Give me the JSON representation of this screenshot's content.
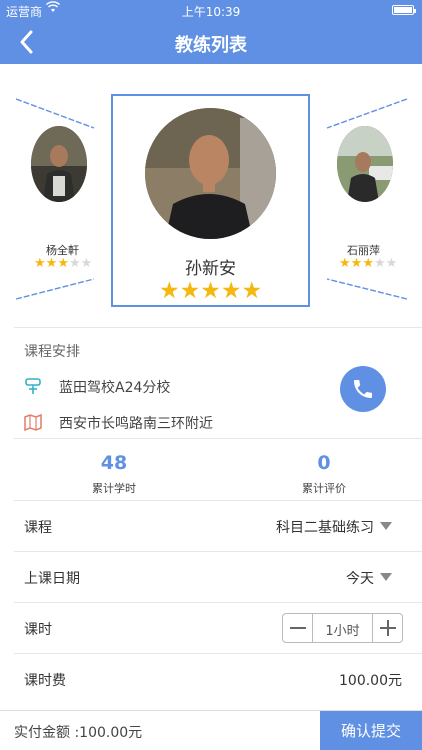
{
  "status_bar": {
    "carrier": "运营商",
    "time": "上午10:39"
  },
  "header": {
    "title": "教练列表",
    "back_icon": "chevron-left-icon"
  },
  "colors": {
    "accent": "#5f90e3",
    "star": "#f5b80f",
    "star_empty": "#d8d8d8"
  },
  "coaches": {
    "left": {
      "name": "杨全軒",
      "rating": 3,
      "max": 5
    },
    "center": {
      "name": "孙新安",
      "rating": 5,
      "max": 5
    },
    "right": {
      "name": "石丽萍",
      "rating": 3,
      "max": 5
    }
  },
  "schedule": {
    "title": "课程安排",
    "school": "蓝田驾校A24分校",
    "address": "西安市长鸣路南三环附近",
    "school_icon": "pin-icon",
    "address_icon": "map-icon",
    "phone_icon": "phone-icon"
  },
  "stats": {
    "hours": {
      "value": "48",
      "label": "累计学时"
    },
    "reviews": {
      "value": "0",
      "label": "累计评价"
    }
  },
  "form": {
    "course": {
      "label": "课程",
      "value": "科目二基础练习"
    },
    "date": {
      "label": "上课日期",
      "value": "今天"
    },
    "duration": {
      "label": "课时",
      "value": "1小时"
    },
    "fee": {
      "label": "课时费",
      "value": "100.00元"
    }
  },
  "footer": {
    "pay_label": "实付金额 :100.00元",
    "submit_label": "确认提交"
  }
}
